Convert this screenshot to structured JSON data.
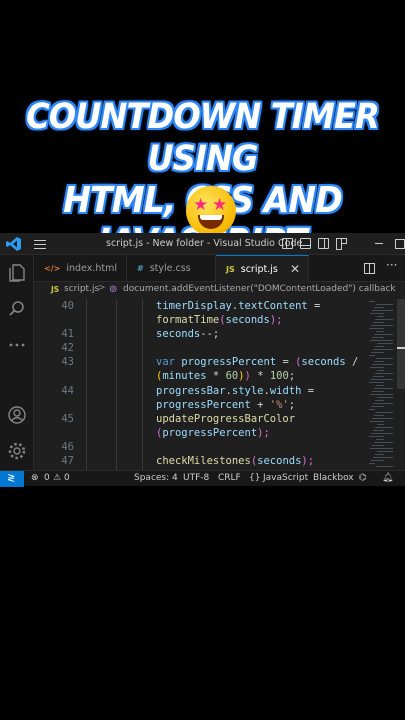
{
  "banner": {
    "line1": "COUNTDOWN TIMER USING",
    "line2": "HTML, CSS AND JAVASCRIPT"
  },
  "window": {
    "title": "script.js - New folder - Visual Studio Code"
  },
  "tabs": [
    {
      "icon": "</>",
      "label": "index.html"
    },
    {
      "icon": "#",
      "label": "style.css"
    },
    {
      "icon": "JS",
      "label": "script.js",
      "close": "✕"
    }
  ],
  "breadcrumb": {
    "file_icon": "JS",
    "file": "script.js",
    "separator": ">",
    "symbol": "document.addEventListener(\"DOMContentLoaded\") callback"
  },
  "editor": {
    "line_numbers": [
      "40",
      "41",
      "42",
      "43",
      "44",
      "45",
      "46",
      "47"
    ],
    "lines": [
      [
        {
          "t": "timerDisplay",
          "c": "v"
        },
        {
          "t": ".",
          "c": "p"
        },
        {
          "t": "textContent",
          "c": "v"
        },
        {
          "t": " =",
          "c": "p"
        }
      ],
      [
        {
          "t": "formatTime",
          "c": "f"
        },
        {
          "t": "(",
          "c": "m"
        },
        {
          "t": "seconds",
          "c": "v"
        },
        {
          "t": ");",
          "c": "m"
        }
      ],
      [
        {
          "t": "seconds",
          "c": "v"
        },
        {
          "t": "--;",
          "c": "p"
        }
      ],
      [],
      [
        {
          "t": "var",
          "c": "k"
        },
        {
          "t": " ",
          "c": "p"
        },
        {
          "t": "progressPercent",
          "c": "v"
        },
        {
          "t": " = ",
          "c": "p"
        },
        {
          "t": "(",
          "c": "m"
        },
        {
          "t": "seconds",
          "c": "v"
        },
        {
          "t": " /",
          "c": "p"
        }
      ],
      [
        {
          "t": "(",
          "c": "y"
        },
        {
          "t": "minutes",
          "c": "v"
        },
        {
          "t": " * ",
          "c": "p"
        },
        {
          "t": "60",
          "c": "n"
        },
        {
          "t": ")",
          "c": "y"
        },
        {
          "t": ")",
          "c": "m"
        },
        {
          "t": " * ",
          "c": "p"
        },
        {
          "t": "100",
          "c": "n"
        },
        {
          "t": ";",
          "c": "p"
        }
      ],
      [
        {
          "t": "progressBar",
          "c": "v"
        },
        {
          "t": ".",
          "c": "p"
        },
        {
          "t": "style",
          "c": "v"
        },
        {
          "t": ".",
          "c": "p"
        },
        {
          "t": "width",
          "c": "v"
        },
        {
          "t": " =",
          "c": "p"
        }
      ],
      [
        {
          "t": "progressPercent",
          "c": "v"
        },
        {
          "t": " + ",
          "c": "p"
        },
        {
          "t": "'%'",
          "c": "s"
        },
        {
          "t": ";",
          "c": "p"
        }
      ],
      [
        {
          "t": "updateProgressBarColor",
          "c": "f"
        }
      ],
      [
        {
          "t": "(",
          "c": "m"
        },
        {
          "t": "progressPercent",
          "c": "v"
        },
        {
          "t": ");",
          "c": "m"
        }
      ],
      [],
      [
        {
          "t": "checkMilestones",
          "c": "f"
        },
        {
          "t": "(",
          "c": "m"
        },
        {
          "t": "seconds",
          "c": "v"
        },
        {
          "t": ");",
          "c": "m"
        }
      ]
    ]
  },
  "status": {
    "errors": "0",
    "warnings": "0",
    "spaces": "Spaces: 4",
    "encoding": "UTF-8",
    "eol": "CRLF",
    "language_icon": "{}",
    "language": "JavaScript",
    "extension": "Blackbox"
  }
}
